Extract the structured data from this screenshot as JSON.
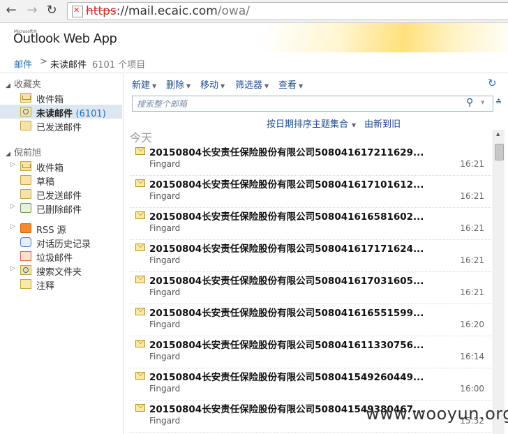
{
  "browser": {
    "back_icon": "back-arrow-icon",
    "forward_icon": "forward-arrow-icon",
    "reload_icon": "reload-icon",
    "url_scheme": "https",
    "url_host": "://mail.ecaic.com",
    "url_path": "/owa/"
  },
  "header": {
    "logo_small": "Microsoft®",
    "logo": "Outlook Web App"
  },
  "breadcrumb": {
    "root": "邮件",
    "sep": ">",
    "folder": "未读邮件",
    "count": "6101 个项目"
  },
  "sidebar": {
    "favorites_label": "收藏夹",
    "favorites": [
      {
        "label": "收件箱",
        "icon": "inbox-folder-icon"
      },
      {
        "label": "未读邮件",
        "count": "(6101)",
        "icon": "search-folder-icon",
        "selected": true
      },
      {
        "label": "已发送邮件",
        "icon": "sent-folder-icon"
      }
    ],
    "mailbox_label": "倪前旭",
    "mailbox": [
      {
        "label": "收件箱",
        "icon": "inbox-folder-icon",
        "expandable": true
      },
      {
        "label": "草稿",
        "icon": "drafts-folder-icon",
        "expandable": false
      },
      {
        "label": "已发送邮件",
        "icon": "sent-folder-icon",
        "expandable": false
      },
      {
        "label": "已删除邮件",
        "icon": "trash-icon",
        "expandable": true
      },
      {
        "label": "RSS 源",
        "icon": "rss-icon",
        "expandable": true
      },
      {
        "label": "对话历史记录",
        "icon": "conversation-history-icon",
        "expandable": false
      },
      {
        "label": "垃圾邮件",
        "icon": "junk-folder-icon",
        "expandable": false
      },
      {
        "label": "搜索文件夹",
        "icon": "search-folder-icon",
        "expandable": true
      },
      {
        "label": "注释",
        "icon": "notes-icon",
        "expandable": false
      }
    ]
  },
  "toolbar": {
    "new_label": "新建",
    "delete_label": "删除",
    "move_label": "移动",
    "filter_label": "筛选器",
    "view_label": "查看"
  },
  "search": {
    "placeholder": "搜索整个邮箱"
  },
  "sort": {
    "order_label": "按日期排序主题集合",
    "direction_label": "由新到旧"
  },
  "list": {
    "group_label": "今天",
    "messages": [
      {
        "subject": "20150804长安责任保险股份有限公司508041617211629...",
        "from": "Fingard",
        "time": "16:21"
      },
      {
        "subject": "20150804长安责任保险股份有限公司508041617101612...",
        "from": "Fingard",
        "time": "16:21"
      },
      {
        "subject": "20150804长安责任保险股份有限公司508041616581602...",
        "from": "Fingard",
        "time": "16:21"
      },
      {
        "subject": "20150804长安责任保险股份有限公司508041617171624...",
        "from": "Fingard",
        "time": "16:21"
      },
      {
        "subject": "20150804长安责任保险股份有限公司508041617031605...",
        "from": "Fingard",
        "time": "16:21"
      },
      {
        "subject": "20150804长安责任保险股份有限公司508041616551599...",
        "from": "Fingard",
        "time": "16:20"
      },
      {
        "subject": "20150804长安责任保险股份有限公司508041611330756...",
        "from": "Fingard",
        "time": "16:14"
      },
      {
        "subject": "20150804长安责任保险股份有限公司508041549260449...",
        "from": "Fingard",
        "time": "16:00"
      },
      {
        "subject": "20150804长安责任保险股份有限公司508041549380467...",
        "from": "Fingard",
        "time": "15:52"
      }
    ]
  },
  "watermark": "www.wooyun.org"
}
